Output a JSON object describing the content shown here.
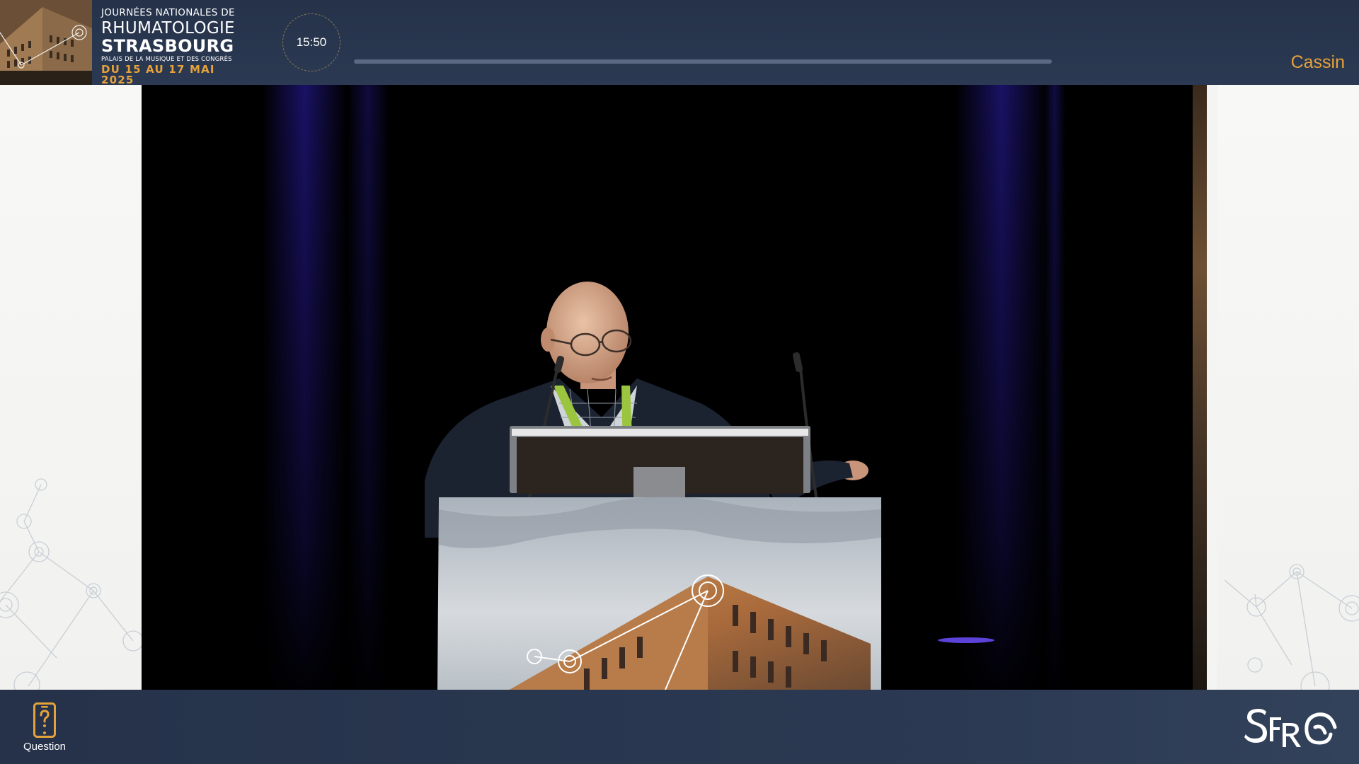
{
  "header": {
    "logo": {
      "line1": "JOURNÉES NATIONALES DE",
      "line2": "RHUMATOLOGIE",
      "line3": "STRASBOURG",
      "line4": "PALAIS DE LA MUSIQUE ET DES CONGRÈS",
      "line5": "DU 15 AU 17 MAI 2025"
    },
    "clock": "15:50",
    "progress_percent": 100,
    "room": "Cassin"
  },
  "footer": {
    "question_label": "Question",
    "question_icon": "smartphone-question-icon",
    "brand_logo": "SFR"
  },
  "colors": {
    "bar_bg": "#25324a",
    "accent": "#e6a23a",
    "text": "#ffffff"
  }
}
